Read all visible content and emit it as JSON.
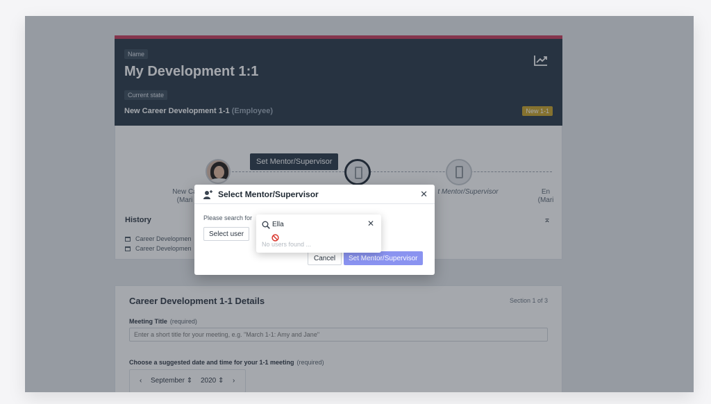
{
  "header": {
    "name_tag": "Name",
    "title": "My Development 1:1",
    "state_tag": "Current state",
    "state_name": "New Career Development 1-1",
    "state_role": "(Employee)",
    "badge": "New 1-1"
  },
  "steps": {
    "tooltip": "Set Mentor/Supervisor",
    "labels": [
      "New Ca\n(Mari",
      "t Mentor/Supervisor",
      "En\n(Mari"
    ]
  },
  "history": {
    "title": "History",
    "items": [
      "Career Developmen",
      "Career Developmen"
    ]
  },
  "details": {
    "title": "Career Development 1-1 Details",
    "section_counter": "Section 1 of 3",
    "meeting_title_label": "Meeting Title",
    "required": "(required)",
    "meeting_title_placeholder": "Enter a short title for your meeting, e.g. \"March 1-1: Amy and Jane\"",
    "date_label": "Choose a suggested date and time for your 1-1 meeting",
    "month": "September",
    "year": "2020"
  },
  "modal": {
    "title": "Select Mentor/Supervisor",
    "prompt": "Please search for",
    "select_user": "Select user",
    "cancel": "Cancel",
    "confirm": "Set Mentor/Supervisor"
  },
  "search": {
    "value": "Ella",
    "no_results": "No users found ..."
  },
  "colors": {
    "header_bg": "#263646",
    "accent_top": "#c83a5a",
    "primary_button": "#8a93f0",
    "badge": "#c9a227"
  }
}
